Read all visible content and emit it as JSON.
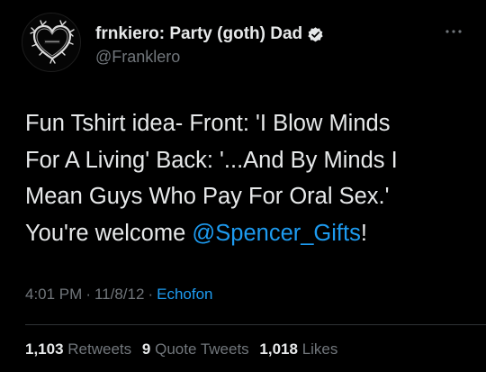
{
  "tweet": {
    "author": {
      "display_name": "frnkiero: Party (goth) Dad",
      "handle": "@Franklero",
      "avatar_icon": "barbed-wire-heart-icon",
      "verified_icon": "verified-badge-icon"
    },
    "more_icon": "more-options-icon",
    "text_lines": [
      "Fun Tshirt idea- Front: 'I Blow Minds",
      "For A Living' Back: '...And By Minds I",
      "Mean Guys Who Pay For Oral Sex.'"
    ],
    "last_line_prefix": "You're welcome ",
    "mention": "@Spencer_Gifts",
    "last_line_suffix": "!",
    "time": "4:01 PM",
    "date": "11/8/12",
    "separator": "·",
    "source": "Echofon",
    "stats": {
      "retweets_count": "1,103",
      "retweets_label": "Retweets",
      "quotes_count": "9",
      "quotes_label": "Quote Tweets",
      "likes_count": "1,018",
      "likes_label": "Likes"
    }
  },
  "colors": {
    "background": "#000000",
    "text": "#e7e9ea",
    "secondary": "#71767b",
    "accent": "#1d9bf0",
    "divider": "#2f3336"
  }
}
